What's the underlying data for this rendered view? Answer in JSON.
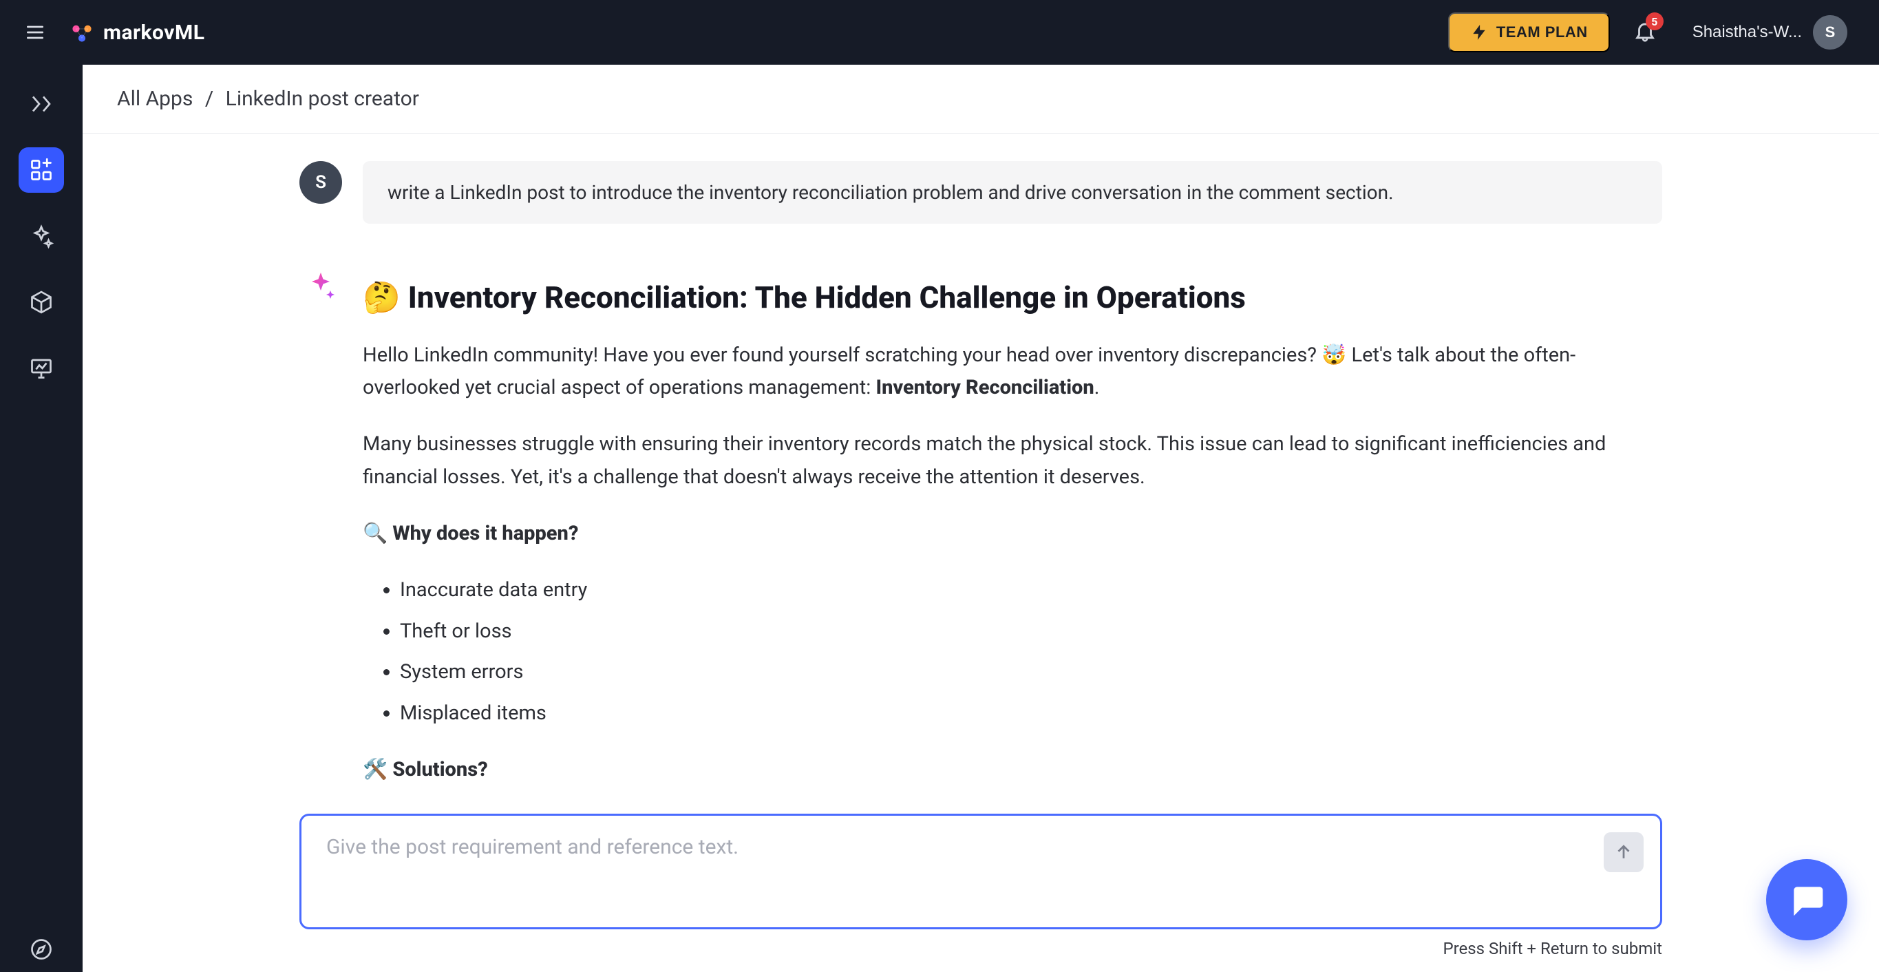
{
  "brand": {
    "name": "markovML"
  },
  "header": {
    "team_plan_label": "TEAM PLAN",
    "notification_count": "5",
    "workspace_label": "Shaistha's-W...",
    "avatar_initial": "S"
  },
  "sidenav": {
    "items": [
      {
        "key": "flows-icon"
      },
      {
        "key": "apps-icon"
      },
      {
        "key": "sparkle-icon"
      },
      {
        "key": "cube-icon"
      },
      {
        "key": "presentation-icon"
      }
    ],
    "footer_key": "compass-icon"
  },
  "breadcrumb": {
    "root": "All Apps",
    "separator": "/",
    "current": "LinkedIn post creator"
  },
  "conversation": {
    "user_avatar_initial": "S",
    "user_message": "write a LinkedIn post to introduce the inventory reconciliation problem and drive conversation in the comment section.",
    "ai": {
      "title": "🤔 Inventory Reconciliation: The Hidden Challenge in Operations",
      "para1_a": "Hello LinkedIn community! Have you ever found yourself scratching your head over inventory discrepancies? 🤯 Let's talk about the often-overlooked yet crucial aspect of operations management: ",
      "para1_bold": "Inventory Reconciliation",
      "para1_b": ".",
      "para2": "Many businesses struggle with ensuring their inventory records match the physical stock. This issue can lead to significant inefficiencies and financial losses. Yet, it's a challenge that doesn't always receive the attention it deserves.",
      "why_heading": "🔍 Why does it happen?",
      "why_bullets": [
        "Inaccurate data entry",
        "Theft or loss",
        "System errors",
        "Misplaced items"
      ],
      "solutions_heading": "🛠️ Solutions?"
    }
  },
  "composer": {
    "placeholder": "Give the post requirement and reference text.",
    "hint": "Press Shift + Return to submit"
  }
}
